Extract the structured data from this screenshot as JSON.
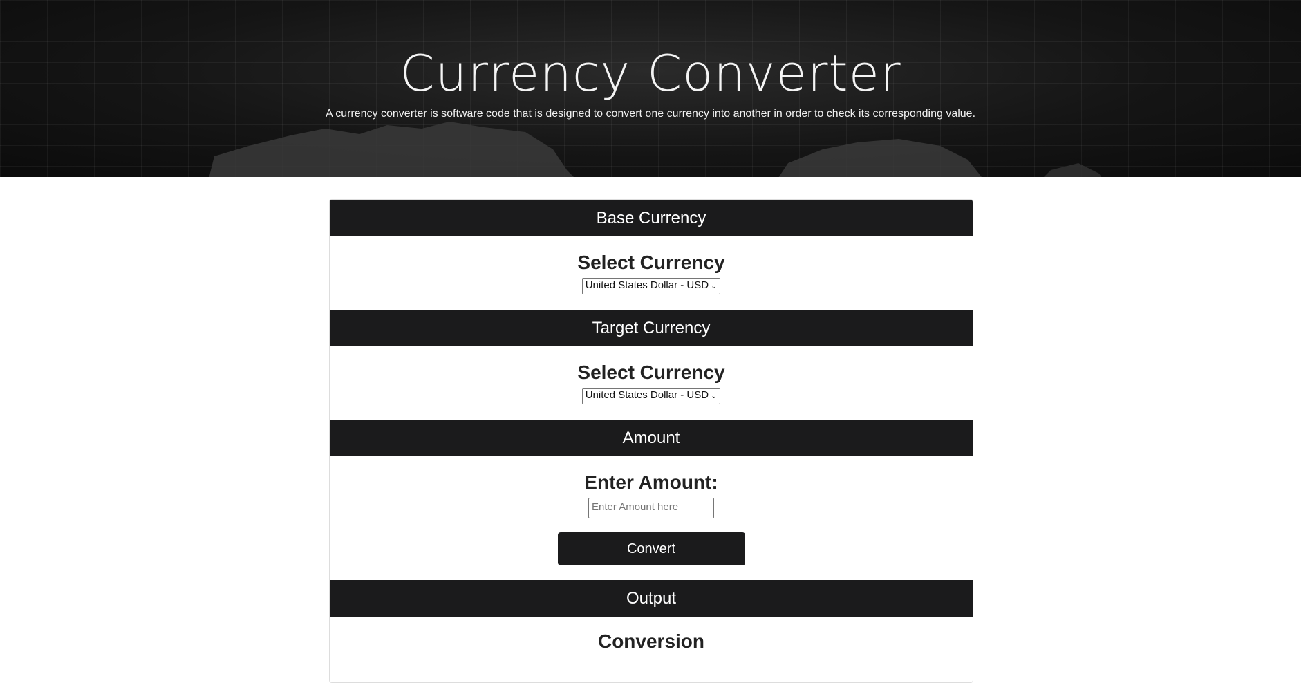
{
  "hero": {
    "title": "Currency Converter",
    "description": "A currency converter is software code that is designed to convert one currency into another in order to check its corresponding value."
  },
  "base": {
    "header": "Base Currency",
    "label": "Select Currency",
    "selected": "United States Dollar - USD"
  },
  "target": {
    "header": "Target Currency",
    "label": "Select Currency",
    "selected": "United States Dollar - USD"
  },
  "amount": {
    "header": "Amount",
    "label": "Enter Amount:",
    "placeholder": "Enter Amount here",
    "button": "Convert"
  },
  "output": {
    "header": "Output",
    "label": "Conversion"
  },
  "colors": {
    "header_bg": "#1b1b1c",
    "button_bg": "#1b1b1c"
  }
}
